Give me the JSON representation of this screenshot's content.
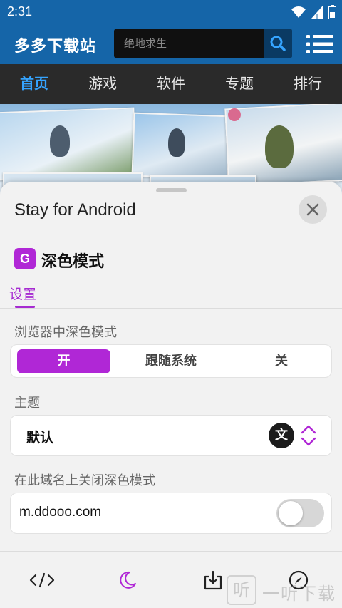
{
  "status_bar": {
    "time": "2:31"
  },
  "site": {
    "logo": "多多下载站",
    "search_placeholder": "绝地求生",
    "nav": [
      {
        "label": "首页",
        "active": true
      },
      {
        "label": "游戏",
        "active": false
      },
      {
        "label": "软件",
        "active": false
      },
      {
        "label": "专题",
        "active": false
      },
      {
        "label": "排行",
        "active": false
      }
    ]
  },
  "sheet": {
    "title": "Stay for Android",
    "extension_icon_letter": "G",
    "extension_name": "深色模式",
    "tab": "设置",
    "browser_dark_mode": {
      "label": "浏览器中深色模式",
      "options": [
        "开",
        "跟随系统",
        "关"
      ],
      "selected": "开"
    },
    "theme": {
      "label": "主题",
      "value": "默认",
      "translate_icon_glyph": "文"
    },
    "disable_on_domain": {
      "label": "在此域名上关闭深色模式",
      "domain": "m.ddooo.com",
      "enabled": false
    }
  },
  "tabbar": {
    "icons": [
      "code-icon",
      "moon-icon",
      "download-icon",
      "compass-icon"
    ],
    "active": "moon-icon"
  },
  "watermark": {
    "glyph": "听",
    "text": "一听下载"
  },
  "colors": {
    "header_blue": "#1565a8",
    "nav_bg": "#2a2a2a",
    "nav_active": "#35a4ff",
    "accent_purple": "#b027d6"
  }
}
